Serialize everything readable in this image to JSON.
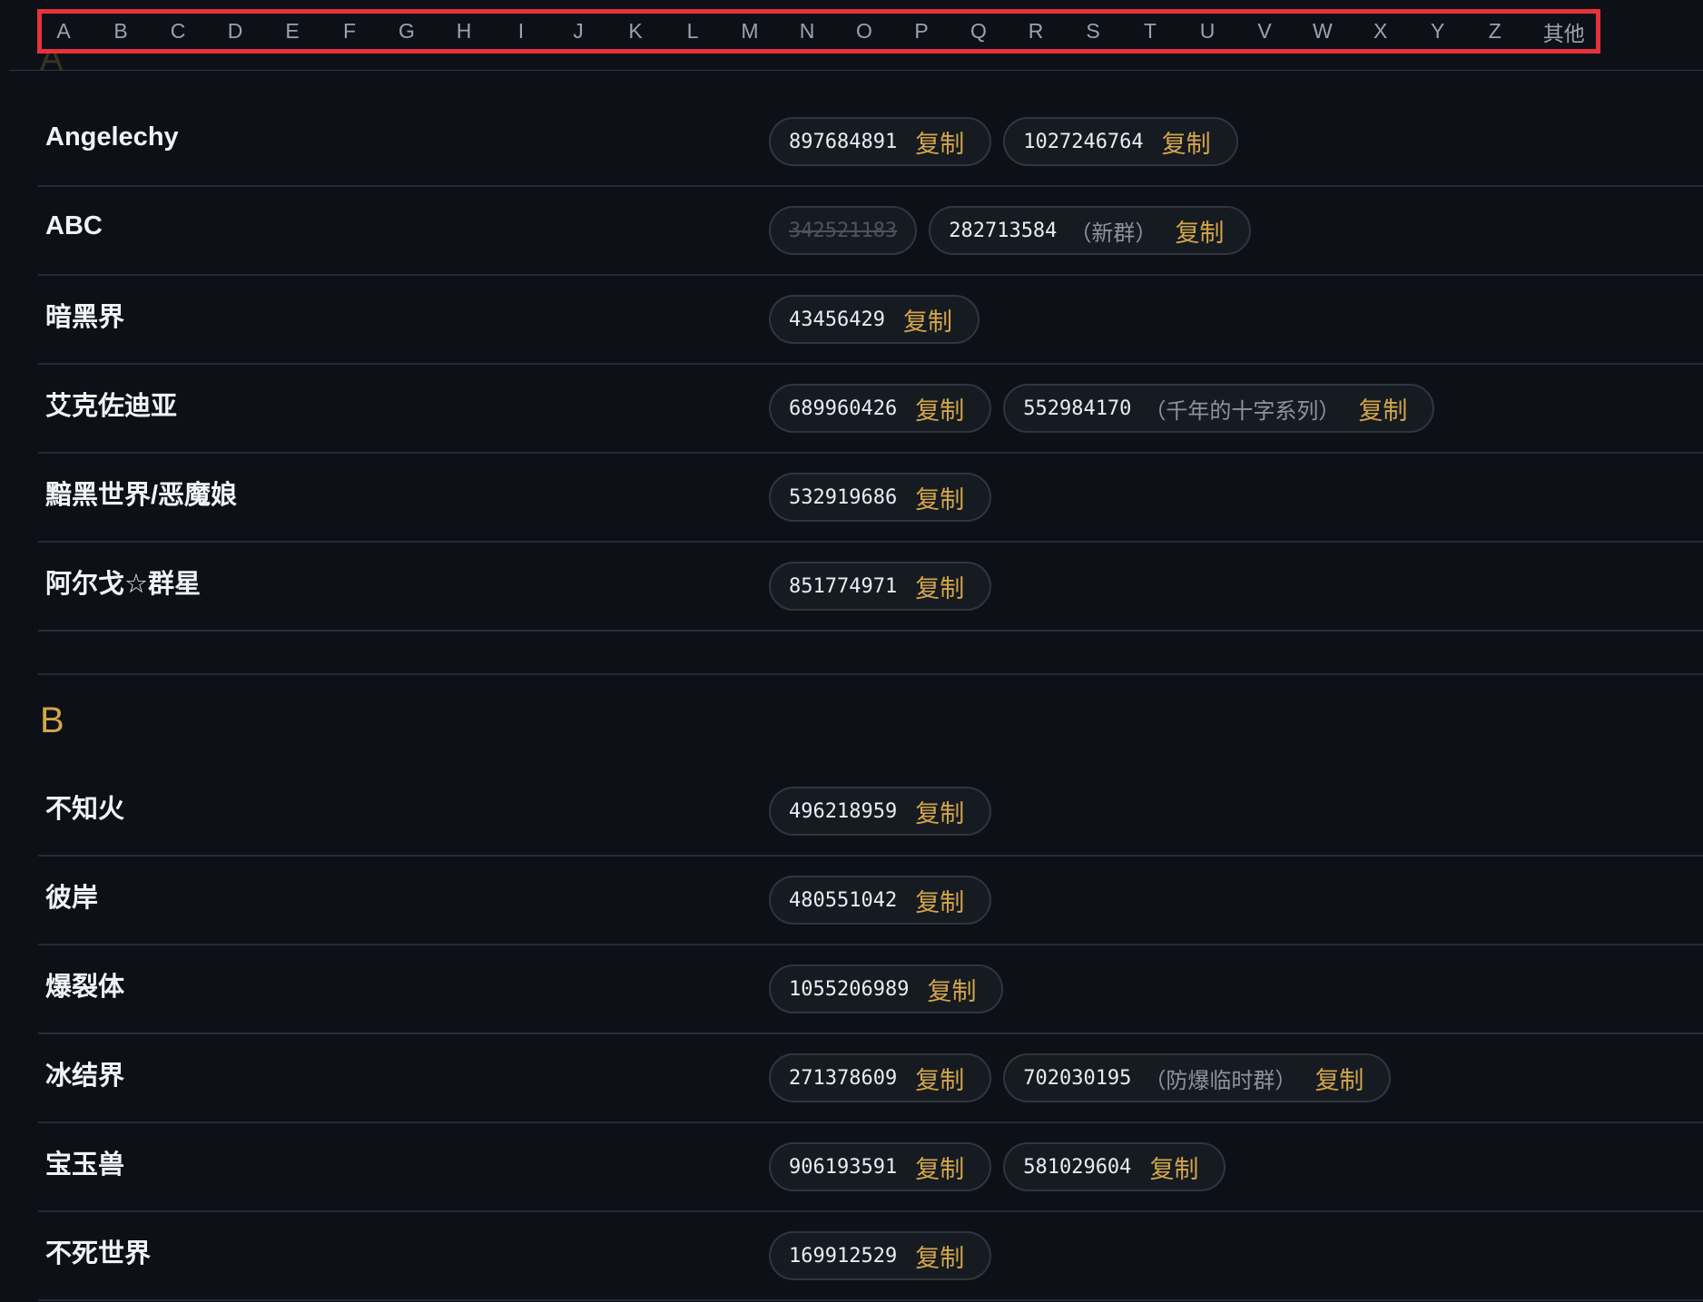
{
  "alphabet_nav": [
    "A",
    "B",
    "C",
    "D",
    "E",
    "F",
    "G",
    "H",
    "I",
    "J",
    "K",
    "L",
    "M",
    "N",
    "O",
    "P",
    "Q",
    "R",
    "S",
    "T",
    "U",
    "V",
    "W",
    "X",
    "Y",
    "Z",
    "其他"
  ],
  "peek_letter": "A",
  "copy_label": "复制",
  "sections": [
    {
      "letter": "A",
      "rows": [
        {
          "name": "Angelechy",
          "groups": [
            {
              "number": "897684891"
            },
            {
              "number": "1027246764"
            }
          ]
        },
        {
          "name": "ABC",
          "groups": [
            {
              "number": "342521183",
              "disabled": true
            },
            {
              "number": "282713584",
              "note": "（新群）"
            }
          ]
        },
        {
          "name": "暗黑界",
          "groups": [
            {
              "number": "43456429"
            }
          ]
        },
        {
          "name": "艾克佐迪亚",
          "groups": [
            {
              "number": "689960426"
            },
            {
              "number": "552984170",
              "note": "（千年的十字系列）"
            }
          ]
        },
        {
          "name": "黯黑世界/恶魔娘",
          "groups": [
            {
              "number": "532919686"
            }
          ]
        },
        {
          "name": "阿尔戈☆群星",
          "groups": [
            {
              "number": "851774971"
            }
          ]
        }
      ]
    },
    {
      "letter": "B",
      "rows": [
        {
          "name": "不知火",
          "groups": [
            {
              "number": "496218959"
            }
          ]
        },
        {
          "name": "彼岸",
          "groups": [
            {
              "number": "480551042"
            }
          ]
        },
        {
          "name": "爆裂体",
          "groups": [
            {
              "number": "1055206989"
            }
          ]
        },
        {
          "name": "冰结界",
          "groups": [
            {
              "number": "271378609"
            },
            {
              "number": "702030195",
              "note": "（防爆临时群）"
            }
          ]
        },
        {
          "name": "宝玉兽",
          "groups": [
            {
              "number": "906193591"
            },
            {
              "number": "581029604"
            }
          ]
        },
        {
          "name": "不死世界",
          "groups": [
            {
              "number": "169912529"
            }
          ]
        }
      ]
    }
  ],
  "colors": {
    "background": "#0d1117",
    "accent": "#d4a54a",
    "highlight_border": "#e5323b"
  }
}
